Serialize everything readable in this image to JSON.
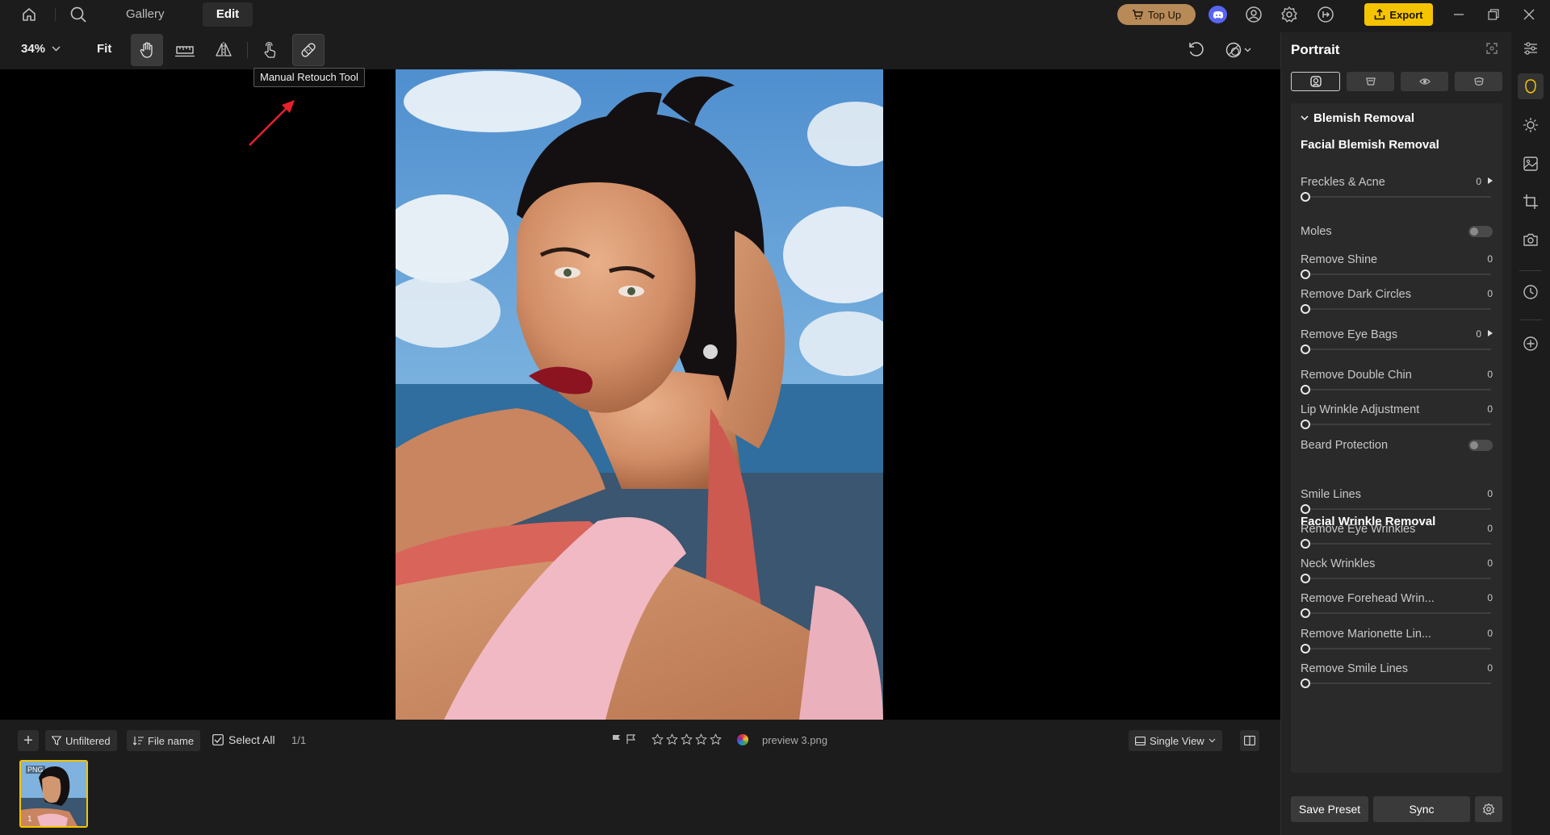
{
  "titlebar": {
    "tabs": {
      "gallery": "Gallery",
      "edit": "Edit"
    },
    "topup_label": "Top Up",
    "export_label": "Export",
    "icons": [
      "home-icon",
      "search-icon",
      "discord-icon",
      "account-icon",
      "settings-icon",
      "sign-out-icon",
      "minimize-icon",
      "restore-icon",
      "close-icon"
    ]
  },
  "toolbar": {
    "zoom": "34%",
    "fit": "Fit",
    "tools": [
      "hand-tool",
      "straighten-tool",
      "flip-tool",
      "touch-tool",
      "manual-retouch-tool"
    ],
    "active_tool": "manual-retouch-tool",
    "tooltip": "Manual Retouch Tool"
  },
  "canvas": {
    "image_name": "preview 3.png"
  },
  "bottombar": {
    "filter_label": "Unfiltered",
    "sort_label": "File name",
    "select_all_label": "Select All",
    "count": "1/1",
    "file_name": "preview 3.png",
    "rating": 0,
    "view_mode": "Single View",
    "thumb": {
      "badge": "PNG",
      "index": "1"
    }
  },
  "panel": {
    "title": "Portrait",
    "section": "Blemish Removal",
    "subsections": {
      "facial_blemish": "Facial Blemish Removal",
      "facial_wrinkle": "Facial Wrinkle Removal"
    },
    "rows": [
      {
        "label": "Freckles & Acne",
        "value": "0",
        "kind": "slider",
        "expandable": true
      },
      {
        "label": "Moles",
        "kind": "toggle",
        "on": false
      },
      {
        "label": "Remove Shine",
        "value": "0",
        "kind": "slider"
      },
      {
        "label": "Remove Dark Circles",
        "value": "0",
        "kind": "slider"
      },
      {
        "label": "Remove Eye Bags",
        "value": "0",
        "kind": "slider",
        "expandable": true
      },
      {
        "label": "Remove Double Chin",
        "value": "0",
        "kind": "slider"
      },
      {
        "label": "Lip Wrinkle Adjustment",
        "value": "0",
        "kind": "slider"
      },
      {
        "label": "Beard Protection",
        "kind": "toggle",
        "on": false
      },
      {
        "label": "Smile Lines",
        "value": "0",
        "kind": "slider"
      },
      {
        "label": "Remove Eye Wrinkles",
        "value": "0",
        "kind": "slider"
      },
      {
        "label": "Neck Wrinkles",
        "value": "0",
        "kind": "slider"
      },
      {
        "label": "Remove Forehead Wrin...",
        "value": "0",
        "kind": "slider"
      },
      {
        "label": "Remove Marionette Lin...",
        "value": "0",
        "kind": "slider"
      },
      {
        "label": "Remove Smile Lines",
        "value": "0",
        "kind": "slider"
      }
    ],
    "save_preset_label": "Save Preset",
    "sync_label": "Sync"
  },
  "rail": {
    "icons": [
      "adjust-icon",
      "portrait-icon",
      "light-icon",
      "image-icon",
      "crop-icon",
      "camera-icon",
      "history-icon",
      "add-icon"
    ],
    "active": "portrait-icon"
  },
  "colors": {
    "accent": "#f5c400",
    "topup": "#b88a58",
    "discord": "#5865f2",
    "annotation_arrow": "#e8202a"
  }
}
